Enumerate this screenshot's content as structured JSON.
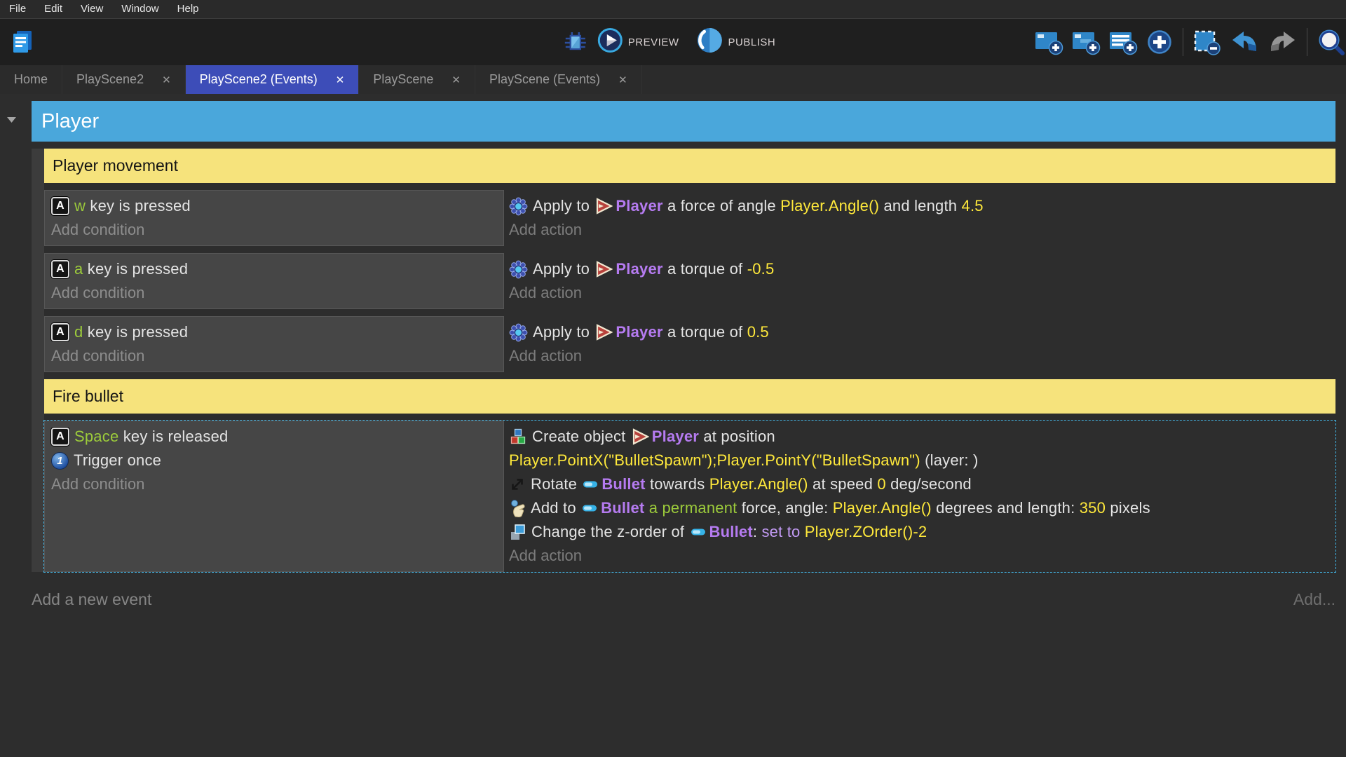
{
  "menu_bar": {
    "items": [
      "File",
      "Edit",
      "View",
      "Window",
      "Help"
    ]
  },
  "toolbar": {
    "app_logo_icon": "app-logo-icon",
    "debug_icon": "debug-icon",
    "preview_label": "PREVIEW",
    "publish_label": "PUBLISH",
    "right_items": [
      "add-event-icon",
      "add-subevent-icon",
      "add-comment-icon",
      "add-circle-icon",
      "separator",
      "remove-event-icon",
      "undo-icon",
      "redo-icon",
      "separator",
      "search-icon"
    ]
  },
  "close_glyph": "✕",
  "tabs": [
    {
      "label": "Home",
      "closable": false,
      "active": false
    },
    {
      "label": "PlayScene2",
      "closable": true,
      "active": false
    },
    {
      "label": "PlayScene2 (Events)",
      "closable": true,
      "active": true
    },
    {
      "label": "PlayScene",
      "closable": true,
      "active": false
    },
    {
      "label": "PlayScene (Events)",
      "closable": true,
      "active": false
    }
  ],
  "sheet": {
    "group": {
      "title": "Player"
    },
    "add_event_label": "Add a new event",
    "add_more_label": "Add...",
    "items": [
      {
        "type": "comment",
        "text": "Player movement"
      },
      {
        "type": "event",
        "selected": false,
        "conditions": [
          {
            "icon": "keyboard-key-icon",
            "segments": [
              {
                "t": "w",
                "c": "green"
              },
              {
                "t": " key is pressed",
                "c": "plain"
              }
            ]
          }
        ],
        "add_condition_label": "Add condition",
        "actions": [
          {
            "icon": "physics-icon",
            "lines": [
              [
                {
                  "t": "Apply to ",
                  "c": "plain"
                },
                {
                  "icon": "player-object-icon"
                },
                {
                  "t": "Player",
                  "c": "object"
                },
                {
                  "t": " a force of angle ",
                  "c": "plain"
                },
                {
                  "t": "Player.Angle()",
                  "c": "expr"
                },
                {
                  "t": " and length ",
                  "c": "plain"
                },
                {
                  "t": "4.5",
                  "c": "expr"
                }
              ]
            ]
          }
        ],
        "add_action_label": "Add action"
      },
      {
        "type": "event",
        "selected": false,
        "conditions": [
          {
            "icon": "keyboard-key-icon",
            "segments": [
              {
                "t": "a",
                "c": "green"
              },
              {
                "t": " key is pressed",
                "c": "plain"
              }
            ]
          }
        ],
        "add_condition_label": "Add condition",
        "actions": [
          {
            "icon": "physics-icon",
            "lines": [
              [
                {
                  "t": "Apply to ",
                  "c": "plain"
                },
                {
                  "icon": "player-object-icon"
                },
                {
                  "t": "Player",
                  "c": "object"
                },
                {
                  "t": " a torque of ",
                  "c": "plain"
                },
                {
                  "t": "-0.5",
                  "c": "expr"
                }
              ]
            ]
          }
        ],
        "add_action_label": "Add action"
      },
      {
        "type": "event",
        "selected": false,
        "conditions": [
          {
            "icon": "keyboard-key-icon",
            "segments": [
              {
                "t": "d",
                "c": "green"
              },
              {
                "t": " key is pressed",
                "c": "plain"
              }
            ]
          }
        ],
        "add_condition_label": "Add condition",
        "actions": [
          {
            "icon": "physics-icon",
            "lines": [
              [
                {
                  "t": "Apply to ",
                  "c": "plain"
                },
                {
                  "icon": "player-object-icon"
                },
                {
                  "t": "Player",
                  "c": "object"
                },
                {
                  "t": " a torque of ",
                  "c": "plain"
                },
                {
                  "t": "0.5",
                  "c": "expr"
                }
              ]
            ]
          }
        ],
        "add_action_label": "Add action"
      },
      {
        "type": "comment",
        "text": "Fire bullet"
      },
      {
        "type": "event",
        "selected": true,
        "conditions": [
          {
            "icon": "keyboard-key-icon",
            "segments": [
              {
                "t": "Space",
                "c": "green"
              },
              {
                "t": " key is released",
                "c": "plain"
              }
            ]
          },
          {
            "icon": "trigger-once-icon",
            "segments": [
              {
                "t": "Trigger once",
                "c": "plain"
              }
            ]
          }
        ],
        "add_condition_label": "Add condition",
        "actions": [
          {
            "icon": "create-object-icon",
            "lines": [
              [
                {
                  "t": "Create object ",
                  "c": "plain"
                },
                {
                  "icon": "player-object-icon"
                },
                {
                  "t": "Player",
                  "c": "object"
                },
                {
                  "t": " at position",
                  "c": "plain"
                }
              ],
              [
                {
                  "t": "Player.PointX(\"BulletSpawn\");Player.PointY(\"BulletSpawn\")",
                  "c": "expr"
                },
                {
                  "t": " (layer: )",
                  "c": "plain"
                }
              ]
            ]
          },
          {
            "icon": "rotate-icon",
            "lines": [
              [
                {
                  "t": "Rotate ",
                  "c": "plain"
                },
                {
                  "icon": "bullet-object-icon"
                },
                {
                  "t": "Bullet",
                  "c": "object"
                },
                {
                  "t": " towards ",
                  "c": "plain"
                },
                {
                  "t": "Player.Angle()",
                  "c": "expr"
                },
                {
                  "t": " at speed ",
                  "c": "plain"
                },
                {
                  "t": "0",
                  "c": "expr"
                },
                {
                  "t": " deg/second",
                  "c": "plain"
                }
              ]
            ]
          },
          {
            "icon": "force-icon",
            "lines": [
              [
                {
                  "t": "Add to ",
                  "c": "plain"
                },
                {
                  "icon": "bullet-object-icon"
                },
                {
                  "t": "Bullet",
                  "c": "object"
                },
                {
                  "t": " a permanent",
                  "c": "green"
                },
                {
                  "t": " force, angle: ",
                  "c": "plain"
                },
                {
                  "t": "Player.Angle()",
                  "c": "expr"
                },
                {
                  "t": " degrees and length: ",
                  "c": "plain"
                },
                {
                  "t": "350",
                  "c": "expr"
                },
                {
                  "t": " pixels",
                  "c": "plain"
                }
              ]
            ]
          },
          {
            "icon": "zorder-icon",
            "lines": [
              [
                {
                  "t": "Change the z-order of ",
                  "c": "plain"
                },
                {
                  "icon": "bullet-object-icon"
                },
                {
                  "t": "Bullet",
                  "c": "object"
                },
                {
                  "t": ": ",
                  "c": "plain"
                },
                {
                  "t": "set to",
                  "c": "purple"
                },
                {
                  "t": " ",
                  "c": "plain"
                },
                {
                  "t": "Player.ZOrder()-2",
                  "c": "expr"
                }
              ]
            ]
          }
        ],
        "add_action_label": "Add action"
      }
    ]
  },
  "colors": {
    "group_header_blue": "#4aa7db",
    "comment_yellow": "#f6e37c",
    "active_tab_indigo": "#3d4db8",
    "object_purple": "#b57bf0",
    "expression_yellow": "#ffe93b",
    "key_green": "#9ccb3b",
    "selection_dash_teal": "#43b7e8"
  }
}
